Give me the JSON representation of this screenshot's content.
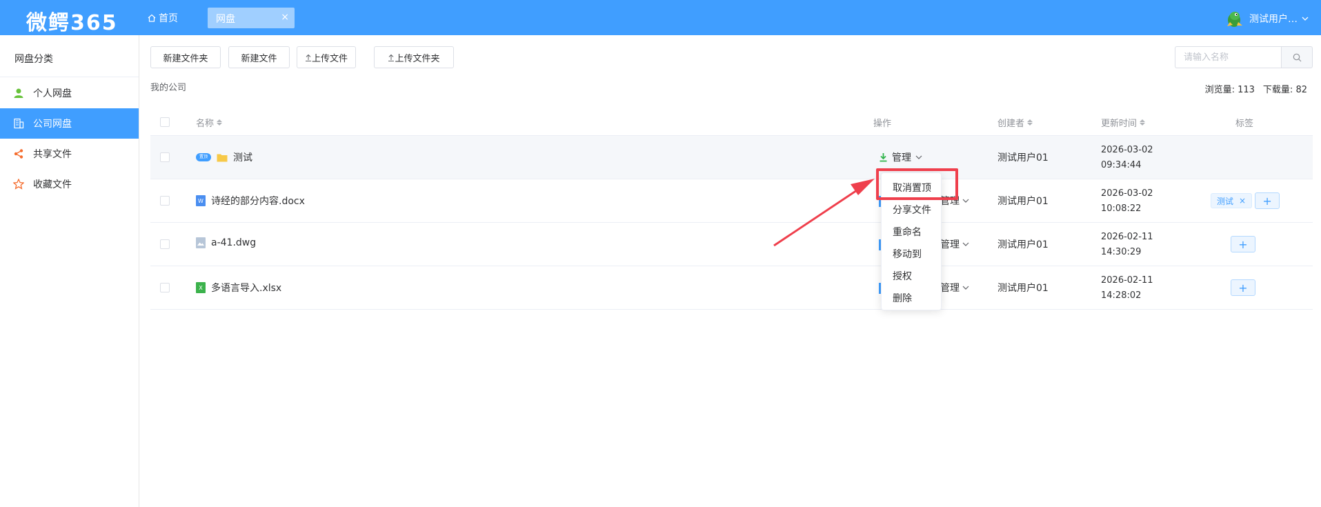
{
  "header": {
    "logo": "微鳄365",
    "home_tab": "首页",
    "active_tab": "网盘",
    "tab_close": "×",
    "user_name": "测试用户…",
    "brand_color": "#409EFF"
  },
  "sidebar": {
    "title": "网盘分类",
    "items": [
      {
        "label": "个人网盘",
        "icon": "user-icon",
        "active": false
      },
      {
        "label": "公司网盘",
        "icon": "building-icon",
        "active": true
      },
      {
        "label": "共享文件",
        "icon": "share-icon",
        "active": false
      },
      {
        "label": "收藏文件",
        "icon": "star-icon",
        "active": false
      }
    ]
  },
  "toolbar": {
    "new_folder": "新建文件夹",
    "new_file": "新建文件",
    "upload_file": "上传文件",
    "upload_folder": "上传文件夹",
    "search_placeholder": "请输入名称"
  },
  "breadcrumb": "我的公司",
  "stats": {
    "views_label": "浏览量:",
    "views_value": "113",
    "downloads_label": "下载量:",
    "downloads_value": "82"
  },
  "table": {
    "headers": {
      "name": "名称",
      "operation": "操作",
      "creator": "创建者",
      "updated": "更新时间",
      "tags": "标签"
    },
    "rows": [
      {
        "name": "测试",
        "type": "folder",
        "pinned": true,
        "pin_label": "置顶",
        "manage": "管理",
        "creator": "测试用户01",
        "date": "2026-03-02",
        "time": "09:34:44",
        "tags": []
      },
      {
        "name": "诗经的部分内容.docx",
        "type": "word",
        "pinned": false,
        "manage": "管理",
        "creator": "测试用户01",
        "date": "2026-03-02",
        "time": "10:08:22",
        "tags": [
          "测试"
        ]
      },
      {
        "name": "a-41.dwg",
        "type": "image",
        "pinned": false,
        "manage": "管理",
        "creator": "测试用户01",
        "date": "2026-02-11",
        "time": "14:30:29",
        "tags": []
      },
      {
        "name": "多语言导入.xlsx",
        "type": "excel",
        "pinned": false,
        "manage": "管理",
        "creator": "测试用户01",
        "date": "2026-02-11",
        "time": "14:28:02",
        "tags": []
      }
    ],
    "tag_close": "×",
    "add_tag": "+"
  },
  "dropdown": {
    "items": [
      "取消置顶",
      "分享文件",
      "重命名",
      "移动到",
      "授权",
      "删除"
    ]
  },
  "annotation_color": "#ef3f4c"
}
